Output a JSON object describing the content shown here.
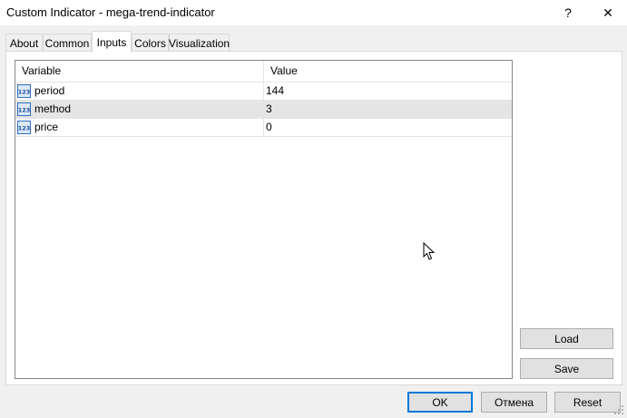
{
  "window": {
    "title": "Custom Indicator - mega-trend-indicator",
    "help_glyph": "?",
    "close_glyph": "✕"
  },
  "tabs": [
    {
      "label": "About"
    },
    {
      "label": "Common"
    },
    {
      "label": "Inputs",
      "active": true
    },
    {
      "label": "Colors"
    },
    {
      "label": "Visualization"
    }
  ],
  "inputs_table": {
    "columns": [
      "Variable",
      "Value"
    ],
    "rows": [
      {
        "variable": "period",
        "value": "144",
        "type_icon": "integer-type-icon"
      },
      {
        "variable": "method",
        "value": "3",
        "type_icon": "integer-type-icon",
        "selected": true
      },
      {
        "variable": "price",
        "value": "0",
        "type_icon": "integer-type-icon"
      }
    ]
  },
  "side_buttons": {
    "load": "Load",
    "save": "Save"
  },
  "footer_buttons": {
    "ok": "OK",
    "cancel": "Отмена",
    "reset": "Reset"
  },
  "colors": {
    "selection": "#e5e5e5",
    "accent": "#0078d7",
    "icon_blue": "#2f6fbf"
  }
}
